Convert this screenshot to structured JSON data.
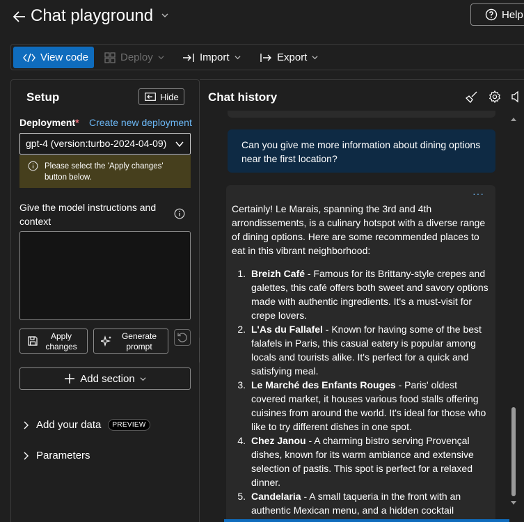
{
  "header": {
    "title": "Chat playground",
    "help_label": "Help"
  },
  "toolbar": {
    "view_code": "View code",
    "deploy": "Deploy",
    "import": "Import",
    "export": "Export"
  },
  "setup": {
    "title": "Setup",
    "hide_label": "Hide",
    "deployment_label": "Deployment",
    "required_mark": "*",
    "create_link": "Create new deployment",
    "deployment_value": "gpt-4 (version:turbo-2024-04-09)",
    "notice": "Please select the 'Apply changes' button below.",
    "instructions_label": "Give the model instructions and context",
    "instructions_value": "",
    "apply_label_1": "Apply",
    "apply_label_2": "changes",
    "generate_label_1": "Generate",
    "generate_label_2": "prompt",
    "add_section": "Add section",
    "add_data": "Add your data",
    "preview_badge": "PREVIEW",
    "parameters": "Parameters"
  },
  "chat": {
    "title": "Chat history",
    "user_message": "Can you give me more information about dining options near the first location?",
    "assistant_intro": "Certainly! Le Marais, spanning the 3rd and 4th arrondissements, is a culinary hotspot with a diverse range of dining options. Here are some recommended places to eat in this vibrant neighborhood:",
    "assistant_items": [
      {
        "num": "1.",
        "name": "Breizh Café",
        "text": " - Famous for its Brittany-style crepes and galettes, this café offers both sweet and savory options made with authentic ingredients. It's a must-visit for crepe lovers."
      },
      {
        "num": "2.",
        "name": "L'As du Fallafel",
        "text": " - Known for having some of the best falafels in Paris, this casual eatery is popular among locals and tourists alike. It's perfect for a quick and satisfying meal."
      },
      {
        "num": "3.",
        "name": "Le Marché des Enfants Rouges",
        "text": " - Paris' oldest covered market, it houses various food stalls offering cuisines from around the world. It's ideal for those who like to try different dishes in one spot."
      },
      {
        "num": "4.",
        "name": "Chez Janou",
        "text": " - A charming bistro serving Provençal dishes, known for its warm ambiance and extensive selection of pastis. This spot is perfect for a relaxed dinner."
      },
      {
        "num": "5.",
        "name": "Candelaria",
        "text": " - A small taqueria in the front with an authentic Mexican menu, and a hidden cocktail"
      }
    ],
    "more_label": "···"
  },
  "colors": {
    "accent": "#0f6cbd",
    "user_bubble": "#0e2a44",
    "notice_bg": "#463f1d",
    "link": "#6cb8f6"
  },
  "icons": [
    "back-arrow-icon",
    "chevron-down-icon",
    "help-icon",
    "code-icon",
    "deploy-icon",
    "import-icon",
    "export-icon",
    "hide-panel-icon",
    "info-icon",
    "save-icon",
    "sparkle-icon",
    "reset-icon",
    "add-icon",
    "chevron-right-icon",
    "broom-icon",
    "gear-icon",
    "speaker-icon"
  ]
}
